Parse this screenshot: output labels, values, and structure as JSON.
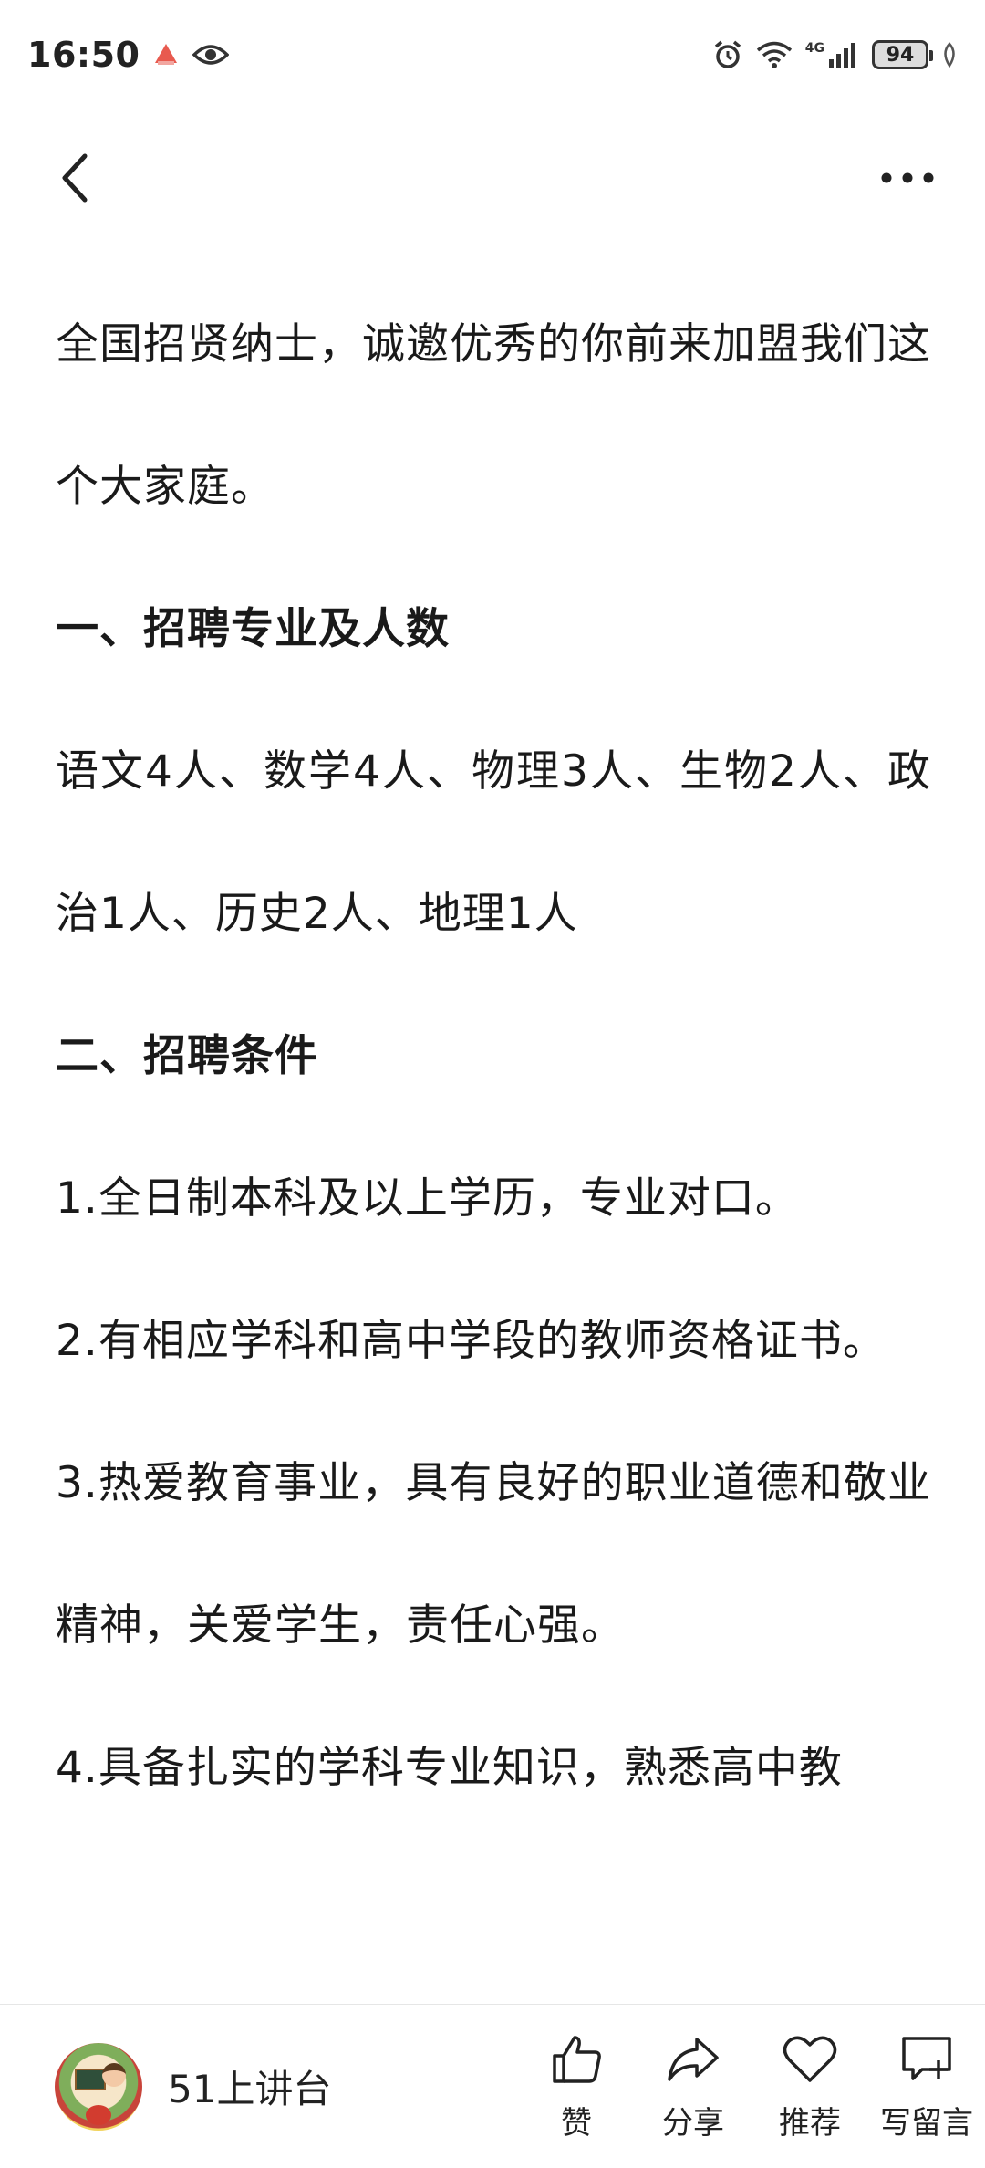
{
  "status_bar": {
    "time": "16:50",
    "network": "4G",
    "battery": "94"
  },
  "nav": {
    "back_icon": "chevron-left-icon",
    "more_icon": "more-horizontal-icon"
  },
  "article": {
    "paragraphs": [
      {
        "text": "全国招贤纳士，诚邀优秀的你前来加盟我们这个大家庭。",
        "heading": false
      },
      {
        "text": "一、招聘专业及人数",
        "heading": true
      },
      {
        "text": "语文4人、数学4人、物理3人、生物2人、政治1人、历史2人、地理1人",
        "heading": false
      },
      {
        "text": "二、招聘条件",
        "heading": true
      },
      {
        "text": "1.全日制本科及以上学历，专业对口。",
        "heading": false
      },
      {
        "text": "2.有相应学科和高中学段的教师资格证书。",
        "heading": false
      },
      {
        "text": "3.热爱教育事业，具有良好的职业道德和敬业精神，关爱学生，责任心强。",
        "heading": false
      },
      {
        "text": "4.具备扎实的学科专业知识，熟悉高中教",
        "heading": false
      }
    ]
  },
  "bottom_bar": {
    "author_name": "51上讲台",
    "actions": [
      {
        "label": "赞",
        "icon": "thumbs-up-icon"
      },
      {
        "label": "分享",
        "icon": "share-icon"
      },
      {
        "label": "推荐",
        "icon": "heart-icon"
      },
      {
        "label": "写留言",
        "icon": "comment-icon"
      }
    ]
  }
}
